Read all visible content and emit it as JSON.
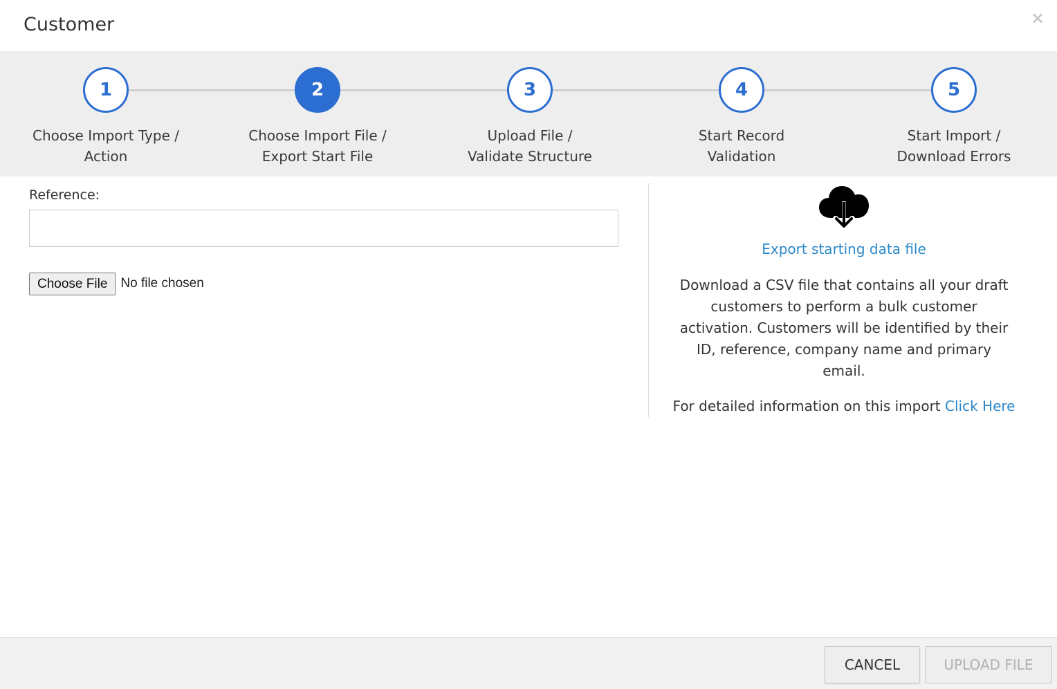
{
  "header": {
    "title": "Customer",
    "close_glyph": "×"
  },
  "wizard": {
    "active_step": 2,
    "accent_color": "#2b6dd1",
    "steps": [
      {
        "number": "1",
        "line1": "Choose Import Type /",
        "line2": "Action"
      },
      {
        "number": "2",
        "line1": "Choose Import File /",
        "line2": "Export Start File"
      },
      {
        "number": "3",
        "line1": "Upload File /",
        "line2": "Validate Structure"
      },
      {
        "number": "4",
        "line1": "Start Record",
        "line2": "Validation"
      },
      {
        "number": "5",
        "line1": "Start Import /",
        "line2": "Download Errors"
      }
    ]
  },
  "form": {
    "reference_label": "Reference:",
    "reference_value": "",
    "choose_file_label": "Choose File",
    "no_file_text": "No file chosen"
  },
  "export": {
    "icon": "cloud-download-icon",
    "link_text": "Export starting data file",
    "description": "Download a CSV file that contains all your draft customers to perform a bulk customer activation. Customers will be identified by their ID, reference, company name and primary email.",
    "info_prefix": "For detailed information on this import",
    "info_link": "Click Here",
    "link_color": "#2b88c8"
  },
  "footer": {
    "cancel_label": "CANCEL",
    "upload_label": "UPLOAD FILE",
    "upload_disabled": true
  }
}
